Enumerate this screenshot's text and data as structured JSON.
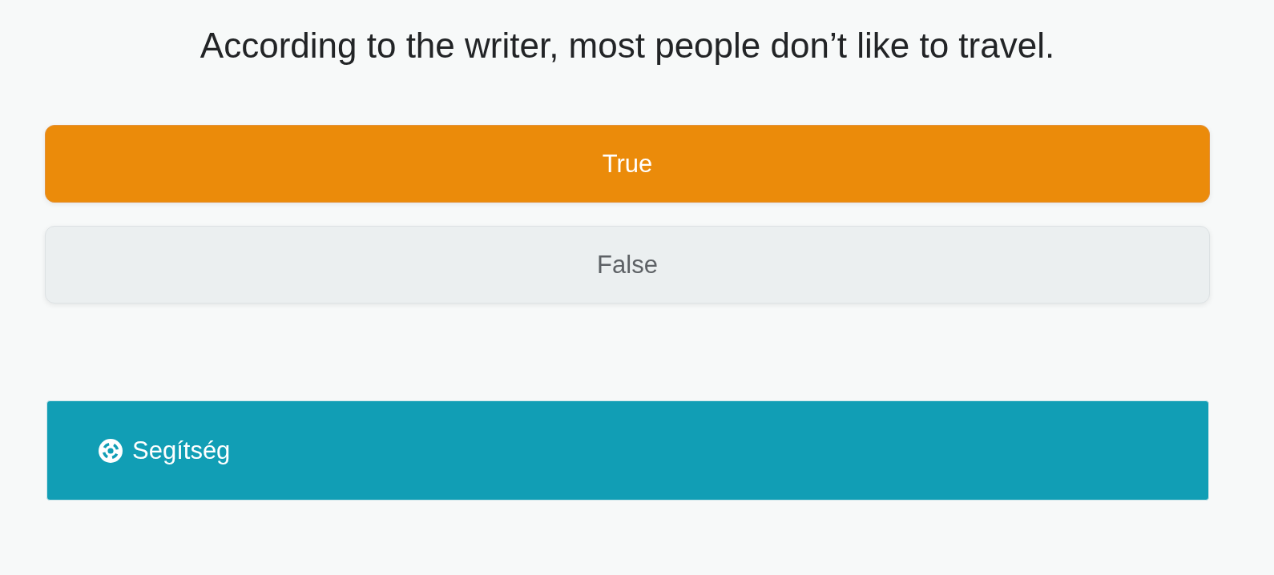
{
  "question": "According to the writer, most people don’t like to travel.",
  "options": [
    {
      "label": "True",
      "selected": true
    },
    {
      "label": "False",
      "selected": false
    }
  ],
  "help": {
    "label": "Segítség"
  }
}
